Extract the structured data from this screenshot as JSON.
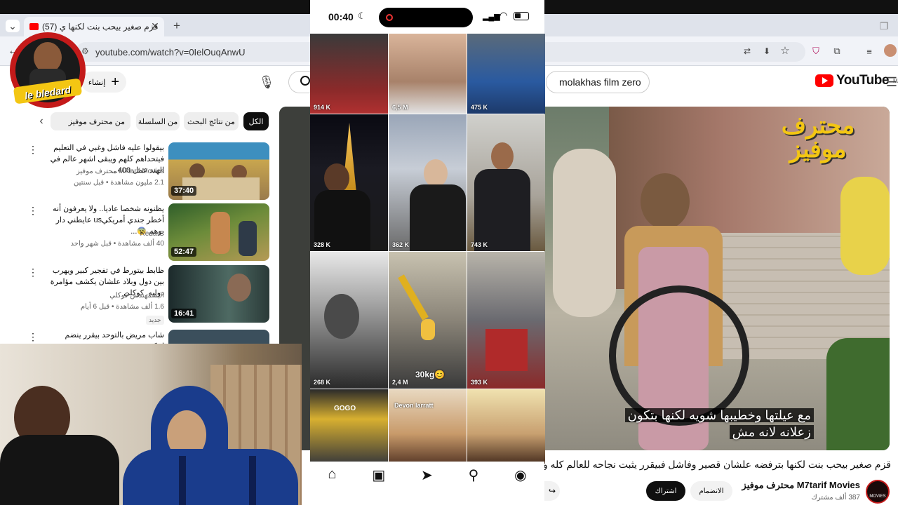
{
  "browser": {
    "tab_title": "(57) قزم صغير بيحب بنت لكنها ي",
    "url": "youtube.com/watch?v=0IelOuqAnwU"
  },
  "youtube": {
    "create_label": "إنشاء",
    "search_query": "molakhas film zero",
    "logo_text": "YouTube",
    "region": "MA",
    "chips": [
      "الكل",
      "من نتائج البحث",
      "من السلسلة",
      "من محترف موفيز",
      "وفيز"
    ],
    "recommendations": [
      {
        "title": "بيقولوا عليه فاشل وغبي في التعليم فيتحداهم كلهم ويبقى اشهر عالم في الهند عمل 400...",
        "channel": "M7tarif Movies محترف موفيز",
        "meta": "2.1 مليون مشاهدة • قبل سنتين",
        "duration": "37:40"
      },
      {
        "title": "يظنونه شخصا عاديا.. ولا يعرفون أنه أخطر جندي أمريكيus عايطني دار بوهم 😨...",
        "channel": "Reda-C",
        "meta": "40 ألف مشاهدة • قبل شهر واحد",
        "duration": "52:47"
      },
      {
        "title": "ظابط بيتورط في تفجير كبير ويهرب بين دول وبلاد علشان يكشف مؤامرة دوليه. كوكلي",
        "channel": "البشمهندس كوكلي",
        "meta": "1.6 ألف مشاهدة • قبل 6 أيام",
        "badge": "جديد",
        "duration": "16:41"
      },
      {
        "title": "شاب مريض بالتوحد بيقرر ينضم لمكتب",
        "channel": "",
        "meta": "",
        "duration": ""
      }
    ],
    "video": {
      "overlay_logo": "محترف موفيز",
      "subtitle_line1": "مع عيلتها وخطيبها شويه لكنها بتكون",
      "subtitle_line2": "زعلانه لانه مش",
      "title": "قزم صغير بيحب بنت لكنها بترفضه علشان قصير وفاشل فبيقرر يثبت نجاحه للعالم كله وبيتح",
      "channel": "M7tarif Movies محترف موفيز",
      "subscribers": "387 ألف مشترك",
      "join_label": "الانضمام",
      "subscribe_label": "اشتراك",
      "channel_avatar_text": "MOVIES"
    }
  },
  "phone": {
    "time": "00:40",
    "views": [
      "914 K",
      "6,5 M",
      "475 K",
      "328 K",
      "362 K",
      "743 K",
      "268 K",
      "2,4 M",
      "393 K",
      "",
      "",
      ""
    ],
    "overlay_texts": [
      "Devon larratt",
      "30kg😊",
      "GOGO"
    ]
  },
  "streamer_logo": "le bledard",
  "colors": {
    "yt_red": "#ff0000",
    "chip_active": "#0f0f0f",
    "brand_yellow": "#f3c613"
  }
}
